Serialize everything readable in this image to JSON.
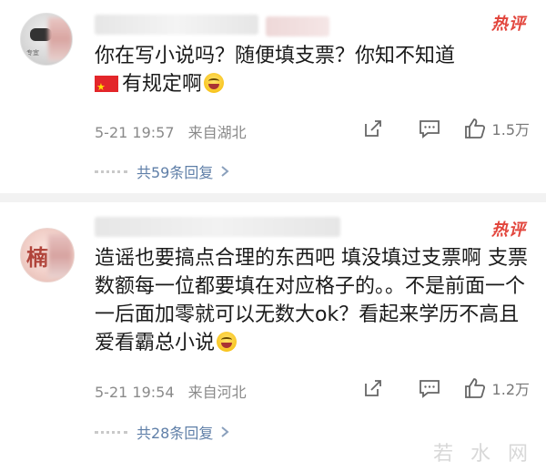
{
  "comments": [
    {
      "username": "",
      "badge": "热评",
      "text": "你在写小说吗？随便填支票？你知不知道",
      "text2": "有规定啊",
      "time": "5-21 19:57",
      "location": "来自湖北",
      "likes": "1.5万",
      "replies": "共59条回复",
      "avatar_caption": "专宜"
    },
    {
      "username": "",
      "badge": "热评",
      "text": "造谣也要搞点合理的东西吧 填没填过支票啊 支票数额每一位都要填在对应格子的。。不是前面一个一后面加零就可以无数大ok？看起来学历不高且爱看霸总小说",
      "time": "5-21 19:54",
      "location": "来自河北",
      "likes": "1.2万",
      "replies": "共28条回复",
      "avatar_caption": "楠"
    }
  ],
  "watermark": "若 水 网",
  "colors": {
    "badge": "#e2453c",
    "reply_link": "#5f7fa8",
    "meta": "#8a8a8a"
  },
  "icons": {
    "share": "share-icon",
    "comment": "comment-icon",
    "like": "like-icon",
    "chevron": "chevron-right-icon",
    "flag": "china-flag-icon",
    "emoji": "laughing-emoji-icon"
  }
}
